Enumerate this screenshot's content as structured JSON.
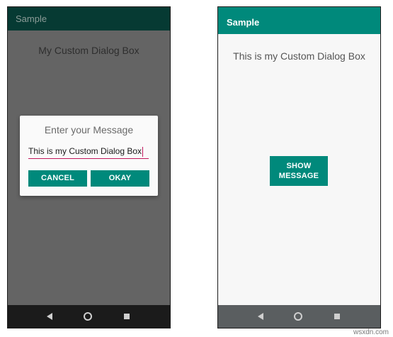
{
  "left_screen": {
    "app_title": "Sample",
    "heading": "My Custom Dialog Box",
    "dialog": {
      "title": "Enter your Message",
      "input_value": "This is my Custom Dialog Box",
      "cancel_label": "CANCEL",
      "okay_label": "OKAY"
    },
    "nav": {
      "back": "back-icon",
      "home": "home-icon",
      "recent": "recents-icon"
    }
  },
  "right_screen": {
    "app_title": "Sample",
    "heading": "This is my Custom Dialog Box",
    "show_button_label": "SHOW\nMESSAGE",
    "nav": {
      "back": "back-icon",
      "home": "home-icon",
      "recent": "recents-icon"
    }
  },
  "watermark": "wsxdn.com",
  "colors": {
    "accent": "#00897b",
    "dark_appbar": "#063a33",
    "input_underline": "#c2185b",
    "dim_background": "#646464"
  }
}
